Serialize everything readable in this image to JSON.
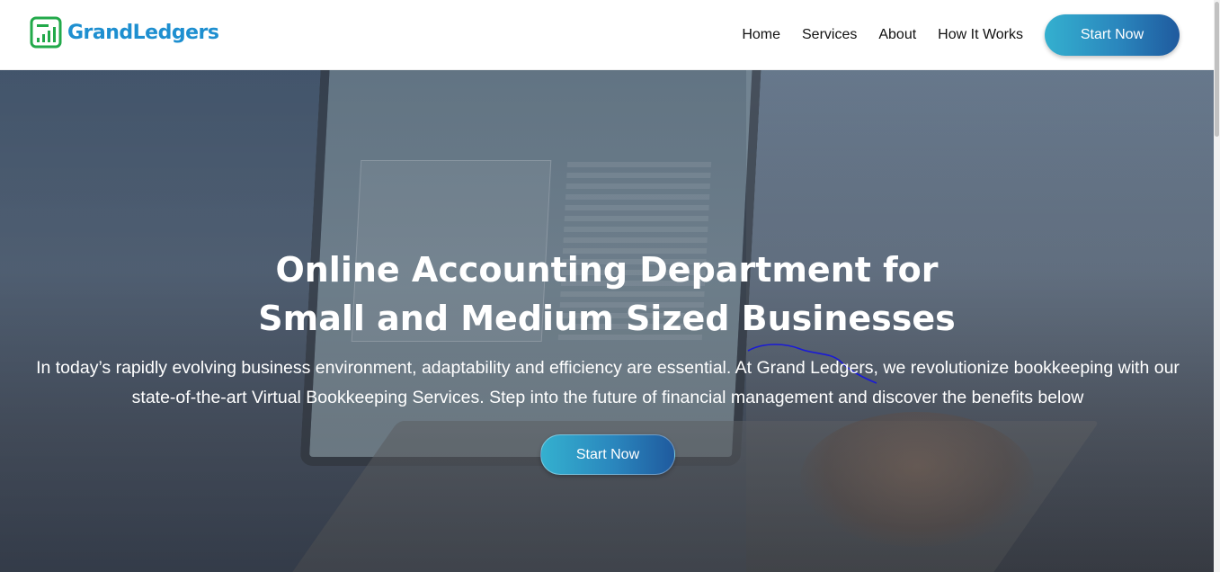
{
  "brand": {
    "name": "GrandLedgers",
    "color": "#1e8fd0",
    "logo_color": "#22a94a"
  },
  "nav": {
    "items": [
      {
        "label": "Home"
      },
      {
        "label": "Services"
      },
      {
        "label": "About"
      },
      {
        "label": "How It Works"
      }
    ],
    "cta_label": "Start Now"
  },
  "hero": {
    "title_line1": "Online Accounting Department for",
    "title_line2": "Small and Medium Sized Businesses",
    "description": "In today’s rapidly evolving business environment, adaptability and efficiency are essential. At Grand Ledgers, we revolutionize bookkeeping with our state-of-the-art Virtual Bookkeeping Services. Step into the future of financial management and discover the benefits below",
    "cta_label": "Start Now"
  },
  "colors": {
    "button_gradient_start": "#34b0cf",
    "button_gradient_end": "#1f5a9e",
    "annotation_stroke": "#1a1ad6"
  }
}
